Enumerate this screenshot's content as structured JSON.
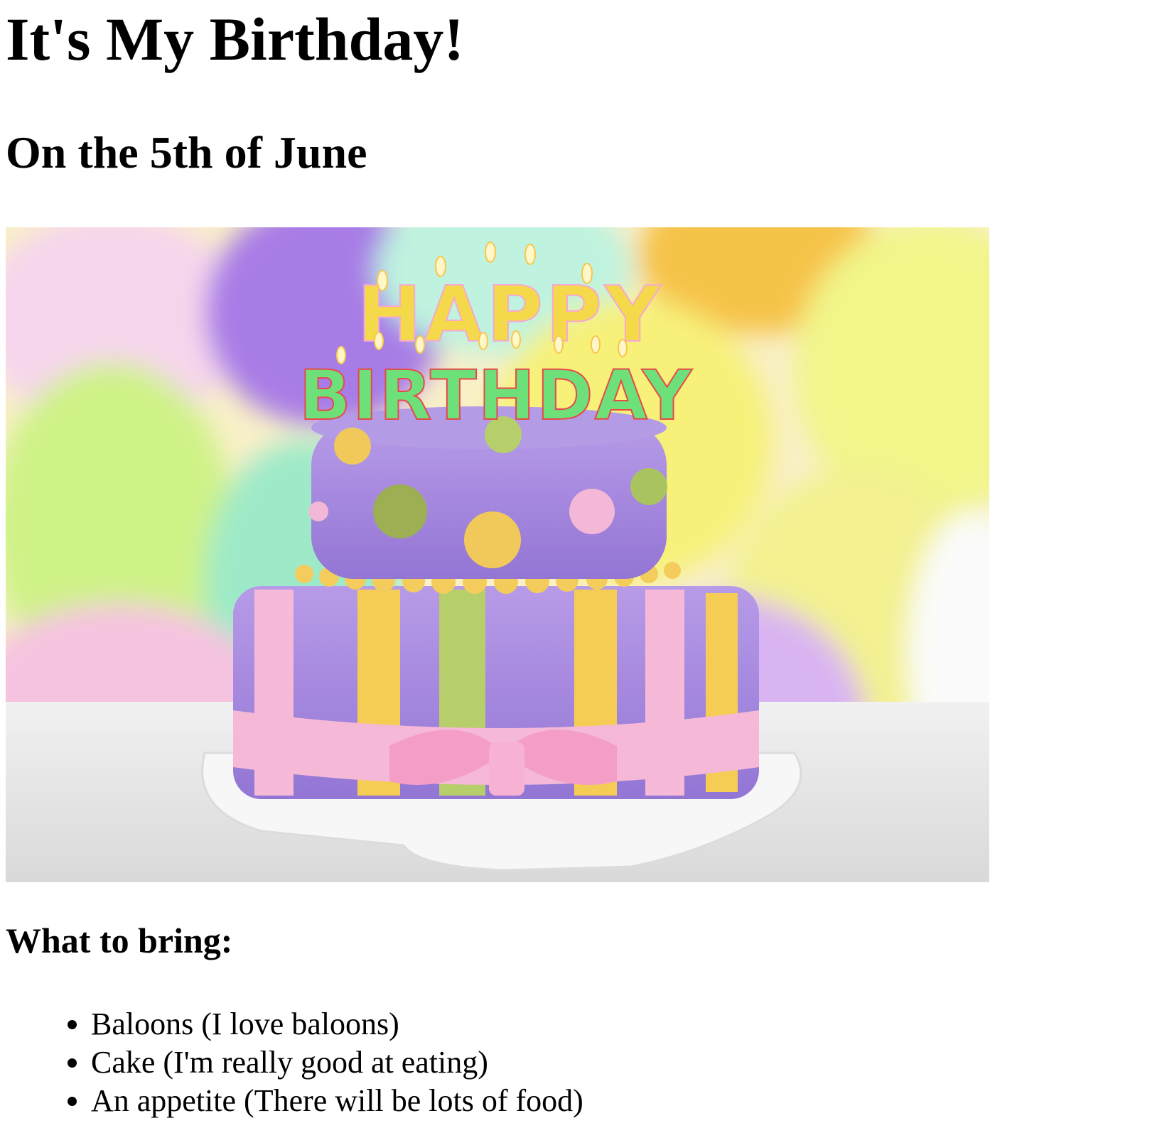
{
  "page": {
    "title": "It's My Birthday!",
    "subtitle": "On the 5th of June"
  },
  "hero": {
    "candle_line_1": "HAPPY",
    "candle_line_2": "BIRTHDAY"
  },
  "bring": {
    "heading": "What to bring:",
    "items": [
      "Baloons (I love baloons)",
      "Cake (I'm really good at eating)",
      "An appetite (There will be lots of food)"
    ]
  },
  "colors": {
    "text": "#000000",
    "background": "#ffffff",
    "cake_lavender": "#a88be0",
    "ribbon_pink": "#f5b8d6",
    "accent_yellow": "#f5cd55",
    "accent_green": "#b6cf6a"
  }
}
